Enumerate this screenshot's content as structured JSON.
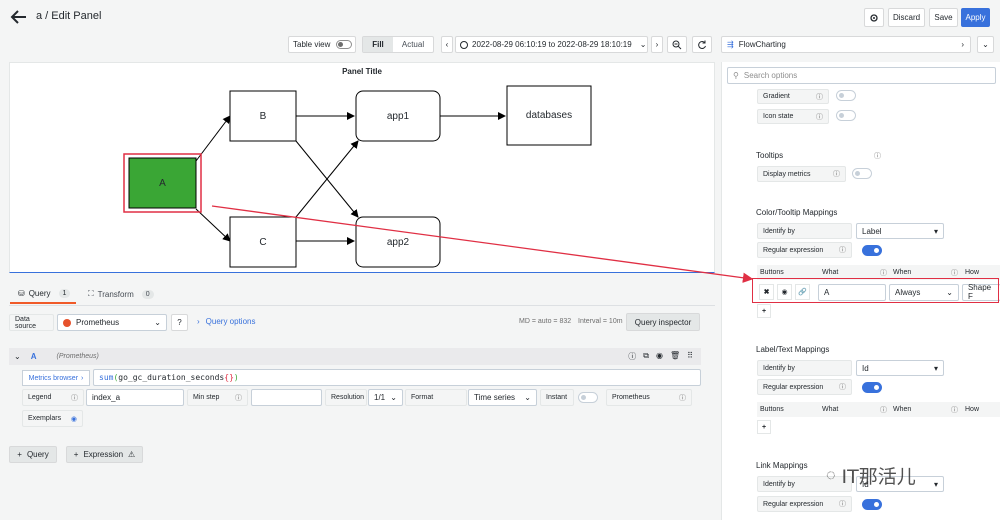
{
  "header": {
    "breadcrumb": "a / Edit Panel",
    "discard": "Discard",
    "save": "Save",
    "apply": "Apply"
  },
  "toolbar": {
    "table_view": "Table view",
    "fill": "Fill",
    "actual": "Actual",
    "time_range": "2022-08-29 06:10:19 to 2022-08-29 18:10:19"
  },
  "viz_picker": {
    "name": "FlowCharting"
  },
  "panel": {
    "title": "Panel Title",
    "nodes": {
      "A": "A",
      "B": "B",
      "C": "C",
      "app1": "app1",
      "app2": "app2",
      "databases": "databases"
    },
    "node_a_color": "#3aa635"
  },
  "query_tabs": {
    "query": "Query",
    "query_count": "1",
    "transform": "Transform",
    "transform_count": "0"
  },
  "datasource": {
    "label": "Data source",
    "value": "Prometheus",
    "query_options": "Query options",
    "md": "MD = auto = 832",
    "interval": "Interval = 10m",
    "inspector": "Query inspector"
  },
  "query_row": {
    "name": "A",
    "source": "(Prometheus)",
    "metrics_browser": "Metrics browser",
    "expr_fn": "sum",
    "expr_metric": "go_gc_duration_seconds",
    "expr_suffix": "{}",
    "legend_label": "Legend",
    "legend_value": "index_a",
    "min_step_label": "Min step",
    "resolution_label": "Resolution",
    "resolution_value": "1/1",
    "format_label": "Format",
    "format_value": "Time series",
    "instant_label": "Instant",
    "prometheus_label": "Prometheus",
    "exemplars_label": "Exemplars"
  },
  "add": {
    "query": "Query",
    "expression": "Expression"
  },
  "options": {
    "search_placeholder": "Search options",
    "gradient": "Gradient",
    "icon_state": "Icon state",
    "tooltips_title": "Tooltips",
    "display_metrics": "Display metrics",
    "color_title": "Color/Tooltip Mappings",
    "identify_by": "Identify by",
    "identify_value_color": "Label",
    "regex": "Regular expression",
    "cols": {
      "buttons": "Buttons",
      "what": "What",
      "when": "When",
      "how": "How"
    },
    "map_what": "A",
    "map_when": "Always",
    "map_how": "Shape F",
    "label_title": "Label/Text Mappings",
    "identify_value_label": "Id",
    "link_title": "Link Mappings",
    "identify_value_link": "Id"
  },
  "watermark": "IT那活儿",
  "colors": {
    "accent": "#3871dc",
    "annotation": "#e02f44"
  }
}
